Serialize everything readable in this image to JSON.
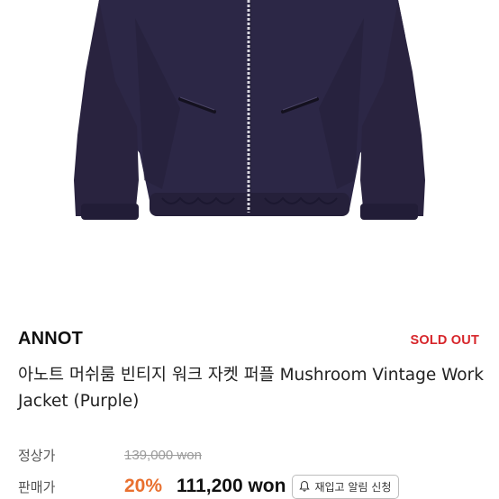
{
  "product": {
    "brand": "ANNOT",
    "status_badge": "SOLD OUT",
    "title": "아노트 머쉬룸 빈티지 워크 자켓 퍼플 Mushroom Vintage Work Jacket (Purple)",
    "image_icon": "jacket-photo"
  },
  "pricing": {
    "original_label": "정상가",
    "original_price": "139,000 won",
    "sale_label": "판매가",
    "discount": "20%",
    "sale_price": "111,200 won"
  },
  "actions": {
    "restock_alert_label": "재입고 알림 신청",
    "restock_icon": "bell-icon"
  },
  "colors": {
    "jacket": "#2d2748",
    "sold_out": "#d7262b",
    "discount": "#e9702f"
  }
}
